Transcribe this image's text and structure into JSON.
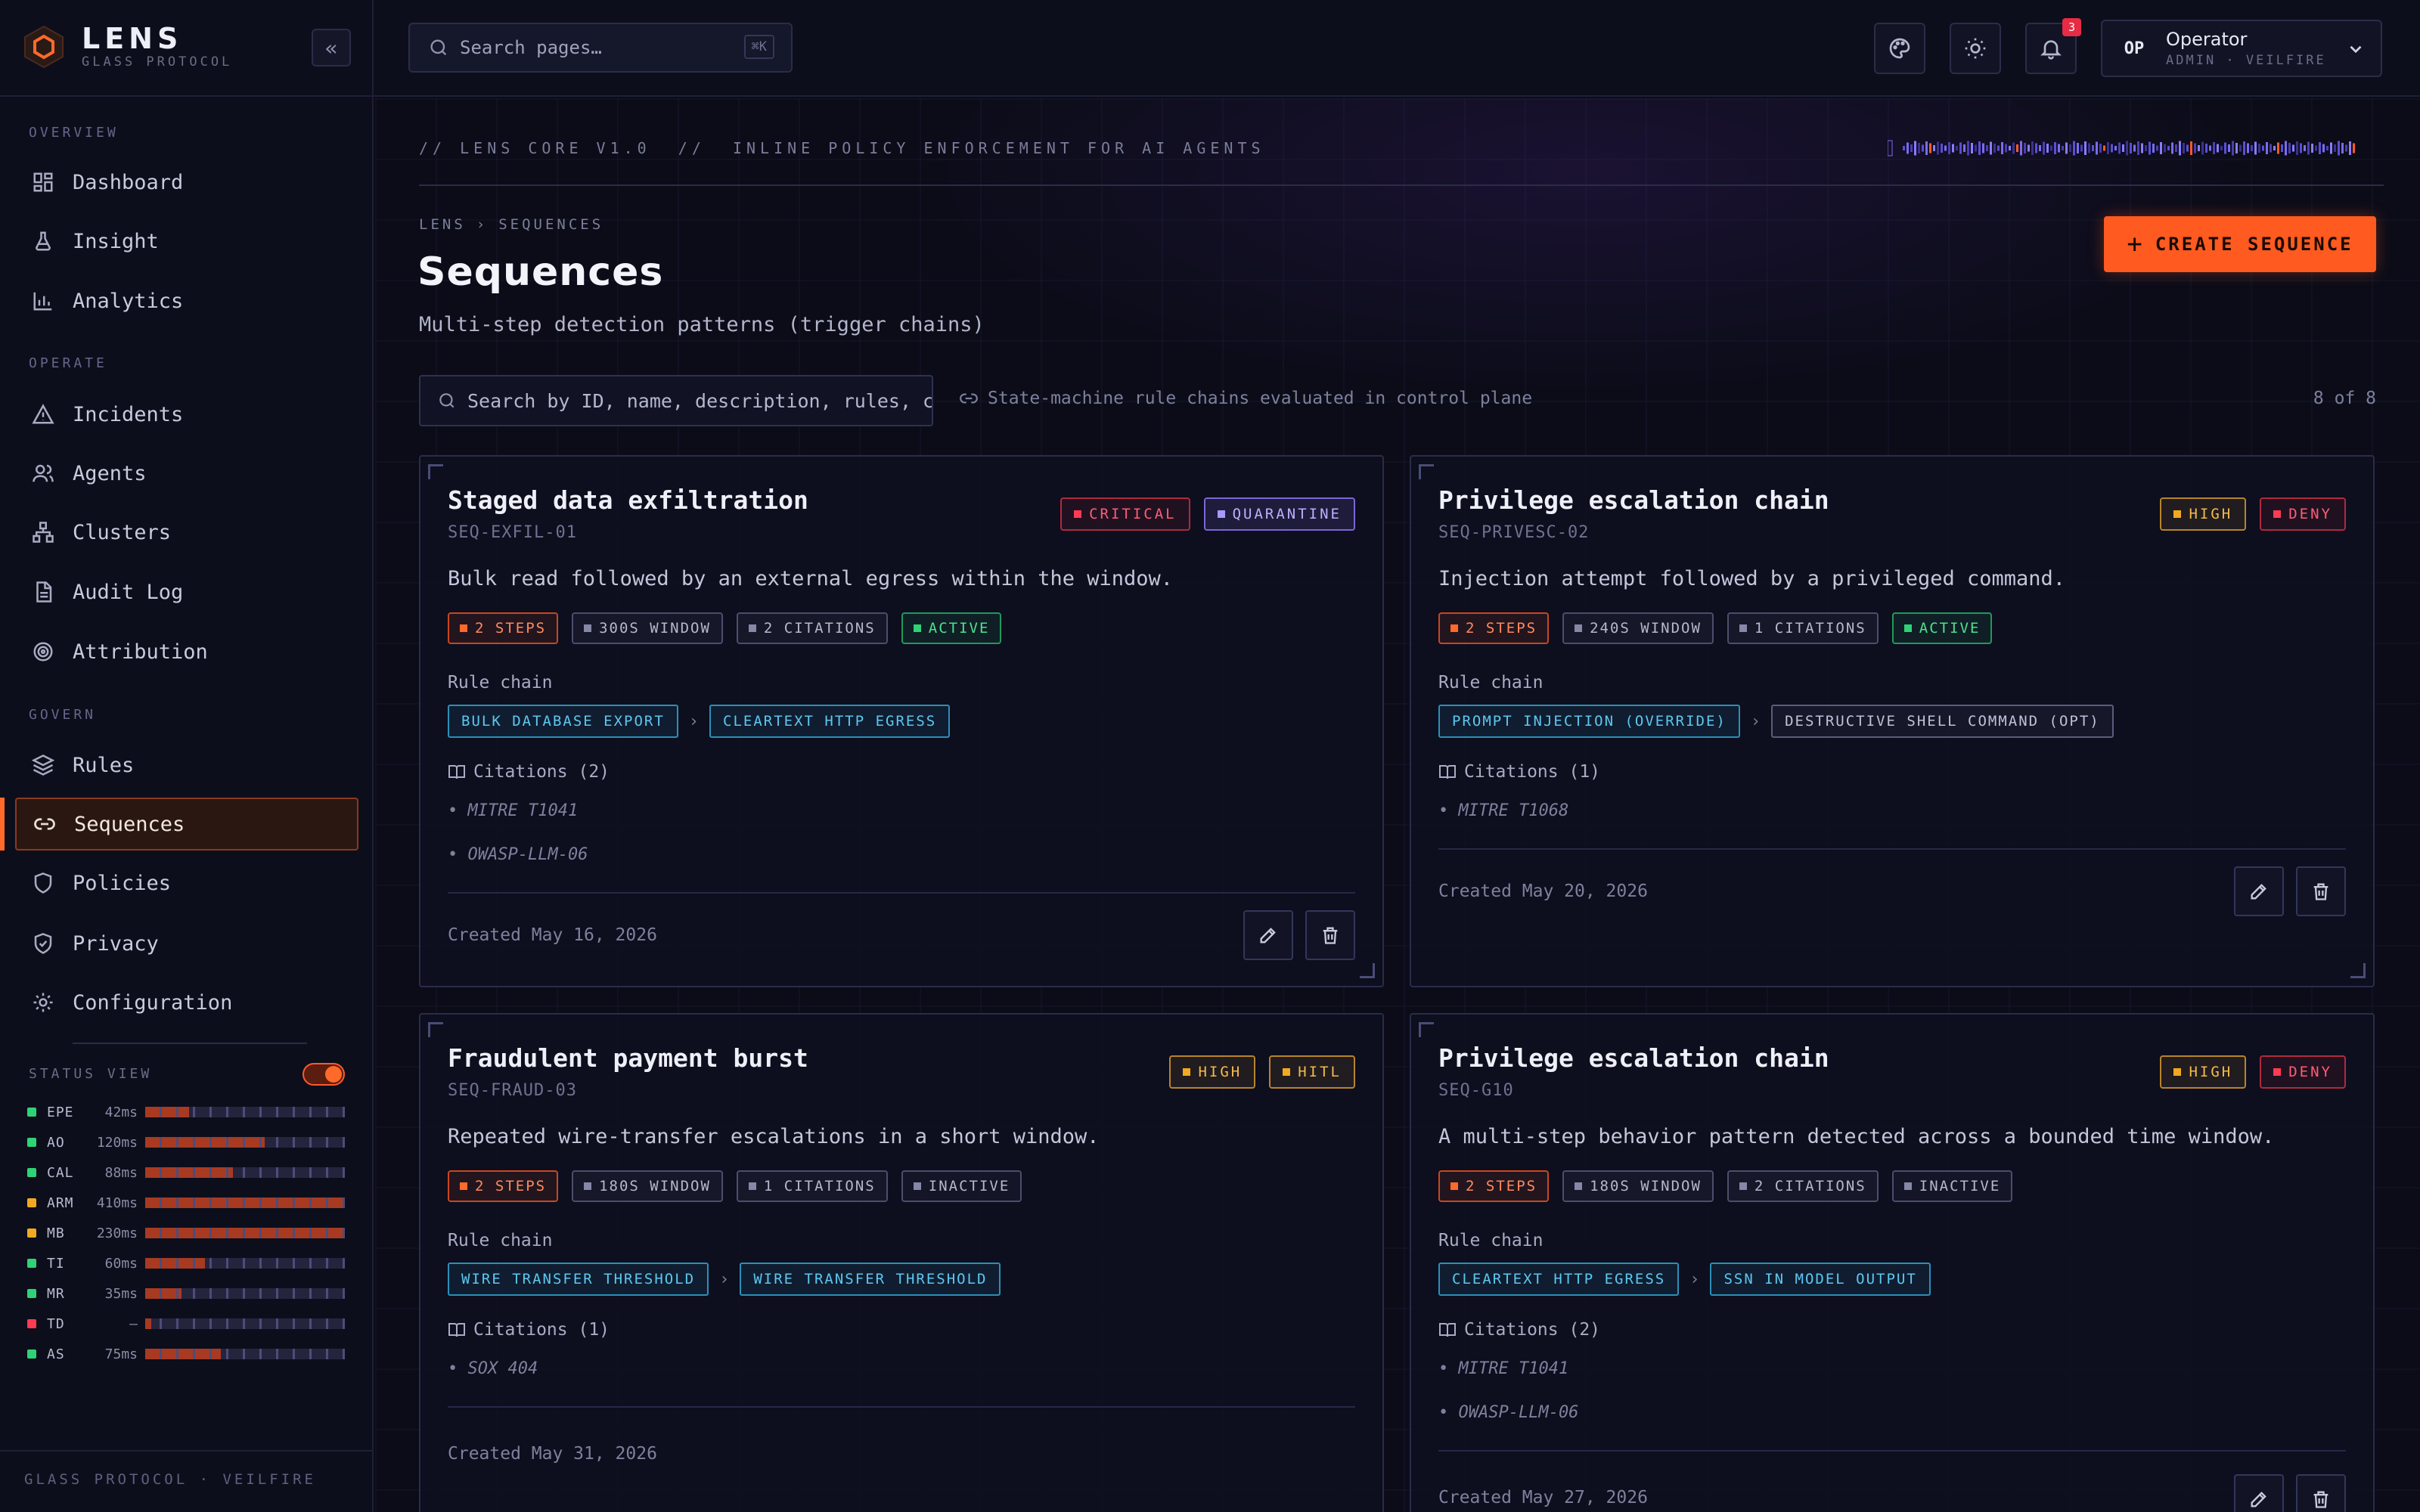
{
  "brand": {
    "name": "LENS",
    "subtitle": "GLASS PROTOCOL",
    "collapse_icon": "double-chevron-left-icon"
  },
  "sidebar": {
    "sections": [
      {
        "label": "OVERVIEW"
      },
      {
        "label": "OPERATE"
      },
      {
        "label": "GOVERN"
      }
    ],
    "items": [
      {
        "label": "Dashboard",
        "icon": "grid-icon"
      },
      {
        "label": "Insight",
        "icon": "flask-icon"
      },
      {
        "label": "Analytics",
        "icon": "bar-chart-icon"
      },
      {
        "label": "Incidents",
        "icon": "warning-icon"
      },
      {
        "label": "Agents",
        "icon": "users-icon"
      },
      {
        "label": "Clusters",
        "icon": "network-icon"
      },
      {
        "label": "Audit Log",
        "icon": "document-icon"
      },
      {
        "label": "Attribution",
        "icon": "target-icon"
      },
      {
        "label": "Rules",
        "icon": "layers-icon"
      },
      {
        "label": "Sequences",
        "icon": "link-icon",
        "active": true
      },
      {
        "label": "Policies",
        "icon": "shield-icon"
      },
      {
        "label": "Privacy",
        "icon": "shield-check-icon"
      },
      {
        "label": "Configuration",
        "icon": "gear-icon"
      }
    ],
    "status_view": {
      "title": "STATUS VIEW",
      "enabled": true,
      "rows": [
        {
          "code": "EPE",
          "latency": "42ms",
          "color": "#2fd275",
          "level": 0.22
        },
        {
          "code": "AO",
          "latency": "120ms",
          "color": "#2fd275",
          "level": 0.6
        },
        {
          "code": "CAL",
          "latency": "88ms",
          "color": "#2fd275",
          "level": 0.44
        },
        {
          "code": "ARM",
          "latency": "410ms",
          "color": "#f2a922",
          "level": 1.0
        },
        {
          "code": "MB",
          "latency": "230ms",
          "color": "#f2a922",
          "level": 1.0
        },
        {
          "code": "TI",
          "latency": "60ms",
          "color": "#2fd275",
          "level": 0.3
        },
        {
          "code": "MR",
          "latency": "35ms",
          "color": "#2fd275",
          "level": 0.18
        },
        {
          "code": "TD",
          "latency": "—",
          "color": "#ff3b52",
          "level": 0.03
        },
        {
          "code": "AS",
          "latency": "75ms",
          "color": "#2fd275",
          "level": 0.38
        }
      ]
    },
    "footer": "GLASS PROTOCOL · VEILFIRE"
  },
  "topbar": {
    "search_placeholder": "Search pages…",
    "search_shortcut": "⌘K",
    "notifications_count": "3",
    "user": {
      "initials": "OP",
      "name": "Operator",
      "role": "ADMIN · VEILFIRE"
    }
  },
  "header": {
    "version_line": "// LENS CORE V1.0  //  INLINE POLICY ENFORCEMENT FOR AI AGENTS",
    "breadcrumb": [
      "LENS",
      "SEQUENCES"
    ],
    "title": "Sequences",
    "subtitle": "Multi-step detection patterns (trigger chains)",
    "create_label": "CREATE SEQUENCE"
  },
  "filter": {
    "placeholder": "Search by ID, name, description, rules, ci",
    "hint": "State-machine rule chains evaluated in control plane",
    "count": "8 of 8"
  },
  "labels": {
    "rule_chain": "Rule chain"
  },
  "cards": [
    {
      "title": "Staged data exfiltration",
      "id": "SEQ-EXFIL-01",
      "badges": [
        {
          "text": "CRITICAL",
          "kind": "critical"
        },
        {
          "text": "QUARANTINE",
          "kind": "quar"
        }
      ],
      "description": "Bulk read followed by an external egress within the window.",
      "meta": [
        {
          "text": "2 STEPS",
          "kind": "steps"
        },
        {
          "text": "300S WINDOW",
          "kind": "grey"
        },
        {
          "text": "2 CITATIONS",
          "kind": "grey"
        },
        {
          "text": "ACTIVE",
          "kind": "active"
        }
      ],
      "rules": [
        {
          "text": "BULK DATABASE EXPORT",
          "kind": "blue"
        },
        {
          "text": "CLEARTEXT HTTP EGRESS",
          "kind": "blue"
        }
      ],
      "citations_label": "Citations (2)",
      "citations": [
        "• MITRE T1041",
        "• OWASP-LLM-06"
      ],
      "created": "Created May 16, 2026"
    },
    {
      "title": "Privilege escalation chain",
      "id": "SEQ-PRIVESC-02",
      "badges": [
        {
          "text": "HIGH",
          "kind": "high"
        },
        {
          "text": "DENY",
          "kind": "deny"
        }
      ],
      "description": "Injection attempt followed by a privileged command.",
      "meta": [
        {
          "text": "2 STEPS",
          "kind": "steps"
        },
        {
          "text": "240S WINDOW",
          "kind": "grey"
        },
        {
          "text": "1 CITATIONS",
          "kind": "grey"
        },
        {
          "text": "ACTIVE",
          "kind": "active"
        }
      ],
      "rules": [
        {
          "text": "PROMPT INJECTION (OVERRIDE)",
          "kind": "blue"
        },
        {
          "text": "DESTRUCTIVE SHELL COMMAND (OPT)",
          "kind": "grey"
        }
      ],
      "citations_label": "Citations (1)",
      "citations": [
        "• MITRE T1068"
      ],
      "created": "Created May 20, 2026"
    },
    {
      "title": "Fraudulent payment burst",
      "id": "SEQ-FRAUD-03",
      "badges": [
        {
          "text": "HIGH",
          "kind": "high"
        },
        {
          "text": "HITL",
          "kind": "hitl"
        }
      ],
      "description": "Repeated wire-transfer escalations in a short window.",
      "meta": [
        {
          "text": "2 STEPS",
          "kind": "steps"
        },
        {
          "text": "180S WINDOW",
          "kind": "grey"
        },
        {
          "text": "1 CITATIONS",
          "kind": "grey"
        },
        {
          "text": "INACTIVE",
          "kind": "inactive"
        }
      ],
      "rules": [
        {
          "text": "WIRE TRANSFER THRESHOLD",
          "kind": "blue"
        },
        {
          "text": "WIRE TRANSFER THRESHOLD",
          "kind": "blue"
        }
      ],
      "citations_label": "Citations (1)",
      "citations": [
        "• SOX 404"
      ],
      "created": "Created May 31, 2026"
    },
    {
      "title": "Privilege escalation chain",
      "id": "SEQ-G10",
      "badges": [
        {
          "text": "HIGH",
          "kind": "high"
        },
        {
          "text": "DENY",
          "kind": "deny"
        }
      ],
      "description": "A multi-step behavior pattern detected across a bounded time window.",
      "meta": [
        {
          "text": "2 STEPS",
          "kind": "steps"
        },
        {
          "text": "180S WINDOW",
          "kind": "grey"
        },
        {
          "text": "2 CITATIONS",
          "kind": "grey"
        },
        {
          "text": "INACTIVE",
          "kind": "inactive"
        }
      ],
      "rules": [
        {
          "text": "CLEARTEXT HTTP EGRESS",
          "kind": "blue"
        },
        {
          "text": "SSN IN MODEL OUTPUT",
          "kind": "blue"
        }
      ],
      "citations_label": "Citations (2)",
      "citations": [
        "• MITRE T1041",
        "• OWASP-LLM-06"
      ],
      "created": "Created May 27, 2026"
    }
  ]
}
